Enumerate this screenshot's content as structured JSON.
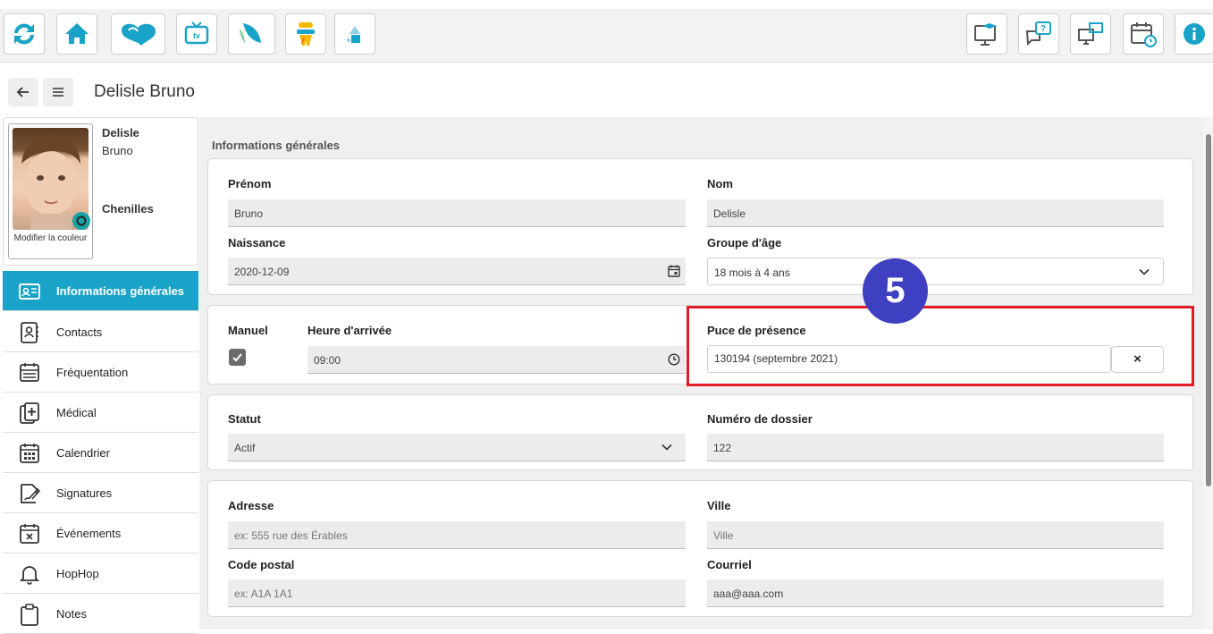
{
  "toolbar": {
    "left_icons": [
      "refresh-icon",
      "home-icon",
      "hophop-logo-icon",
      "tv-icon",
      "wings-icon",
      "character-icon",
      "shapes-icon"
    ],
    "right_icons": [
      "monitor-education-icon",
      "help-chat-icon",
      "sync-screens-icon",
      "calendar-clock-icon",
      "info-icon"
    ]
  },
  "header": {
    "title": "Delisle Bruno"
  },
  "profile": {
    "last_name": "Delisle",
    "first_name": "Bruno",
    "group": "Chenilles",
    "photo_caption": "Modifier la couleur"
  },
  "sidebar": {
    "items": [
      {
        "label": "Informations générales",
        "icon": "id-card-icon"
      },
      {
        "label": "Contacts",
        "icon": "contacts-icon"
      },
      {
        "label": "Fréquentation",
        "icon": "attendance-icon"
      },
      {
        "label": "Médical",
        "icon": "medical-icon"
      },
      {
        "label": "Calendrier",
        "icon": "calendar-icon"
      },
      {
        "label": "Signatures",
        "icon": "signature-icon"
      },
      {
        "label": "Événements",
        "icon": "events-icon"
      },
      {
        "label": "HopHop",
        "icon": "bell-icon"
      },
      {
        "label": "Notes",
        "icon": "clipboard-icon"
      }
    ]
  },
  "main": {
    "section_title": "Informations générales",
    "prenom_label": "Prénom",
    "prenom_value": "Bruno",
    "nom_label": "Nom",
    "nom_value": "Delisle",
    "naissance_label": "Naissance",
    "naissance_value": "2020-12-09",
    "groupe_label": "Groupe d'âge",
    "groupe_value": "18 mois à 4 ans",
    "manuel_label": "Manuel",
    "heure_label": "Heure d'arrivée",
    "heure_value": "09:00",
    "puce_label": "Puce de présence",
    "puce_value": "130194 (septembre 2021)",
    "clear_button": "×",
    "statut_label": "Statut",
    "statut_value": "Actif",
    "dossier_label": "Numéro de dossier",
    "dossier_value": "122",
    "adresse_label": "Adresse",
    "adresse_placeholder": "ex: 555 rue des Érables",
    "ville_label": "Ville",
    "ville_placeholder": "Ville",
    "postal_label": "Code postal",
    "postal_placeholder": "ex: A1A 1A1",
    "courriel_label": "Courriel",
    "courriel_value": "aaa@aaa.com"
  },
  "annotation": {
    "step_number": "5",
    "highlight_color": "#e11d2a",
    "badge_color": "#3f3fc2"
  },
  "colors": {
    "accent": "#1aa3c8"
  }
}
